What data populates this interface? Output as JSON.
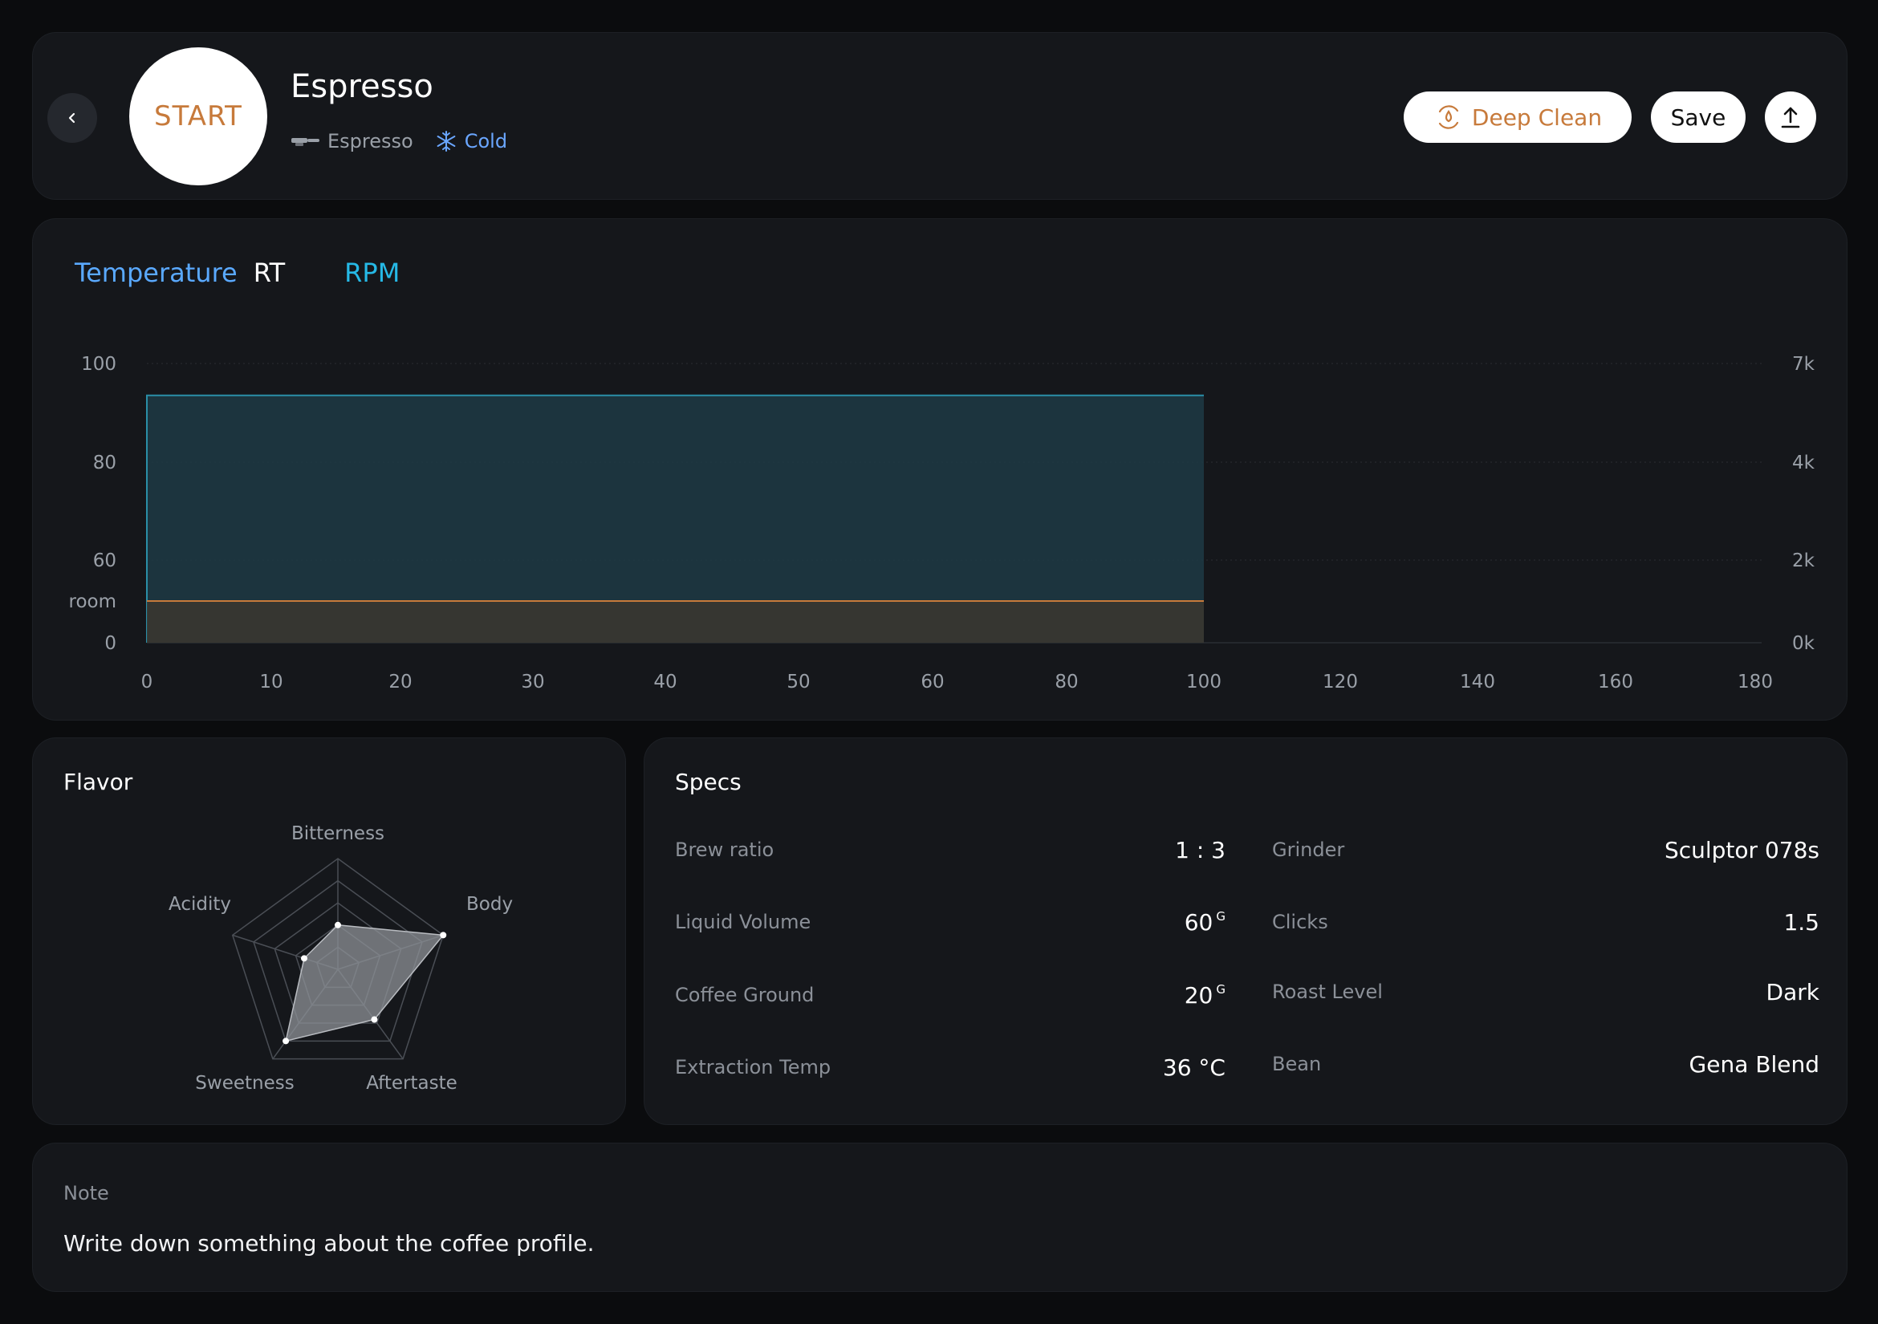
{
  "header": {
    "start_label": "START",
    "profile_name": "Espresso",
    "brew_type": "Espresso",
    "temperature_mode": "Cold",
    "deep_clean_label": "Deep Clean",
    "save_label": "Save"
  },
  "chart_data": {
    "type": "area",
    "legend": [
      "Temperature",
      "RT",
      "RPM"
    ],
    "x_ticks": [
      "0",
      "10",
      "20",
      "30",
      "40",
      "50",
      "60",
      "80",
      "100",
      "120",
      "140",
      "160",
      "180"
    ],
    "y_left_ticks": [
      "100",
      "80",
      "60",
      "room",
      "0"
    ],
    "y_right_ticks": [
      "7k",
      "4k",
      "2k",
      "0k"
    ],
    "series": [
      {
        "name": "RPM",
        "x": [
          0,
          100
        ],
        "y": [
          6200,
          6200
        ],
        "color": "#2a8fa8"
      },
      {
        "name": "Temperature",
        "x": [
          0,
          100
        ],
        "y": [
          "room",
          "room"
        ],
        "color": "#c77a3b"
      }
    ],
    "xlim": [
      0,
      180
    ]
  },
  "flavor": {
    "title": "Flavor",
    "axes": [
      "Bitterness",
      "Body",
      "Aftertaste",
      "Sweetness",
      "Acidity"
    ],
    "values": [
      0.4,
      1.0,
      0.56,
      0.8,
      0.32
    ]
  },
  "specs": {
    "title": "Specs",
    "left": [
      {
        "label": "Brew ratio",
        "value": "1 : 3",
        "unit": ""
      },
      {
        "label": "Liquid Volume",
        "value": "60",
        "unit": "G"
      },
      {
        "label": "Coffee Ground",
        "value": "20",
        "unit": "G"
      },
      {
        "label": "Extraction Temp",
        "value": "36 °C",
        "unit": ""
      }
    ],
    "right": [
      {
        "label": "Grinder",
        "value": "Sculptor 078s"
      },
      {
        "label": "Clicks",
        "value": "1.5"
      },
      {
        "label": "Roast Level",
        "value": "Dark"
      },
      {
        "label": "Bean",
        "value": "Gena Blend"
      }
    ]
  },
  "note": {
    "label": "Note",
    "text": "Write down something about the coffee profile."
  },
  "colors": {
    "accent": "#c77a3b",
    "cold": "#6aa6ff",
    "rpm": "#26b9e6",
    "temperature": "#5aa9ff",
    "card": "#15171b"
  }
}
